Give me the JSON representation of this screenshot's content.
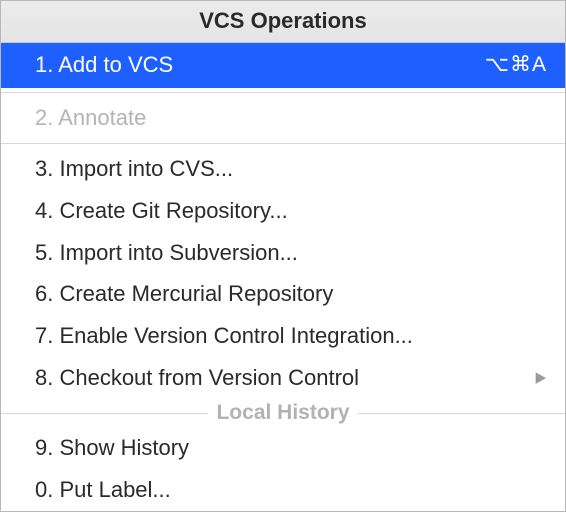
{
  "title": "VCS Operations",
  "items": [
    {
      "label": "1. Add to VCS",
      "shortcut": "⌥⌘A",
      "selected": true
    },
    {
      "label": "2. Annotate",
      "disabled": true
    },
    {
      "label": "3. Import into CVS..."
    },
    {
      "label": "4. Create Git Repository..."
    },
    {
      "label": "5. Import into Subversion..."
    },
    {
      "label": "6. Create Mercurial Repository"
    },
    {
      "label": "7. Enable Version Control Integration..."
    },
    {
      "label": "8. Checkout from Version Control",
      "submenu": true
    }
  ],
  "section": {
    "label": "Local History",
    "items": [
      {
        "label": "9. Show History"
      },
      {
        "label": "0. Put Label..."
      }
    ]
  }
}
